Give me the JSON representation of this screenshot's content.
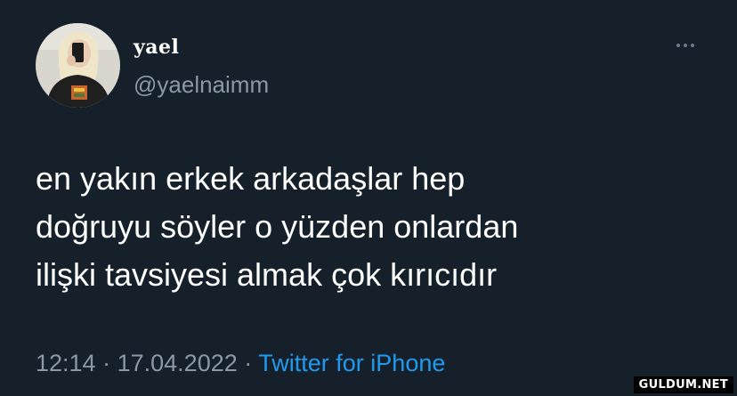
{
  "tweet": {
    "display_name": "yael",
    "handle": "@yaelnaimm",
    "text_lines": [
      "en yakın erkek arkadaşlar hep",
      "doğruyu söyler o yüzden onlardan",
      "ilişki tavsiyesi almak çok kırıcıdır"
    ],
    "time": "12:14",
    "separator_1": "·",
    "date": "17.04.2022",
    "separator_2": "·",
    "source": "Twitter for iPhone",
    "more_icon": "more-horizontal-icon",
    "avatar_icon": "profile-photo"
  },
  "watermark": "GULDUM.NET",
  "colors": {
    "background": "#15202b",
    "text_primary": "#ffffff",
    "text_secondary": "#8b98a5",
    "link": "#1d9bf0"
  }
}
